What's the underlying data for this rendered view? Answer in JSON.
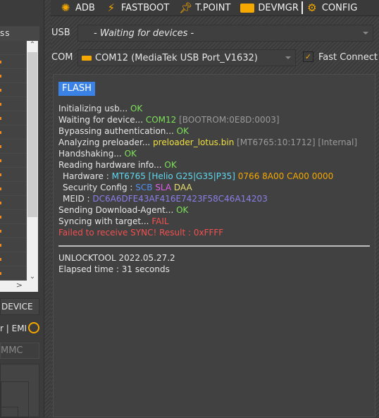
{
  "toolbar": {
    "items": [
      {
        "label": "ADB",
        "icon": "bug-icon"
      },
      {
        "label": "FASTBOOT",
        "icon": "lightning-icon"
      },
      {
        "label": "T.POINT",
        "icon": "pin-icon"
      },
      {
        "label": "DEVMGR",
        "icon": "toolbox-icon"
      },
      {
        "label": "CONFIG",
        "icon": "gear-icon"
      }
    ]
  },
  "usb": {
    "label": "USB",
    "value": "- Waiting for devices -"
  },
  "com": {
    "label": "COM",
    "value": "COM12 (MediaTek USB Port_V1632)",
    "fast_connect": "Fast Connect",
    "fast_connect_checked": true
  },
  "left": {
    "header": "ss",
    "device_button": "DEVICE",
    "emi_label": "r | EMI",
    "storage_value": "MMC",
    "scroll_up": "^",
    "scroll_down": "v",
    "scroll_right": ">"
  },
  "log": {
    "badge": "FLASH",
    "l1": [
      "Initializing usb... ",
      "OK"
    ],
    "l2": [
      "Waiting for device... ",
      "COM12",
      " [BOOTROM:0E8D:0003]"
    ],
    "l3": [
      "Bypassing authentication... ",
      "OK"
    ],
    "l4": [
      "Analyzing preloader... ",
      "preloader_lotus.bin",
      " [MT6765:10:1712] [Internal]"
    ],
    "l5": [
      "Handshaking... ",
      "OK"
    ],
    "l6": [
      "Reading hardware info... ",
      "OK"
    ],
    "l7": [
      "Hardware : ",
      "MT6765 [Helio G25|G35|P35]",
      " 0766 8A00 CA00 0000"
    ],
    "l8": [
      "Security Config : ",
      "SCB",
      " SLA",
      " DAA"
    ],
    "l9": [
      "MEID : ",
      "DC6A6DFE43AF416E7423F58C46A14203"
    ],
    "l10": [
      "Sending Download-Agent... ",
      "OK"
    ],
    "l11": [
      "Syncing with target... ",
      "FAIL"
    ],
    "l12": "Failed to receive SYNC! Result : 0xFFFF",
    "version": "UNLOCKTOOL 2022.05.27.2",
    "elapsed": "Elapsed time : 31 seconds"
  },
  "colors": {
    "accent": "#f5a800",
    "badge": "#3a82e6",
    "ok": "#7de05a",
    "fail": "#f05050"
  }
}
